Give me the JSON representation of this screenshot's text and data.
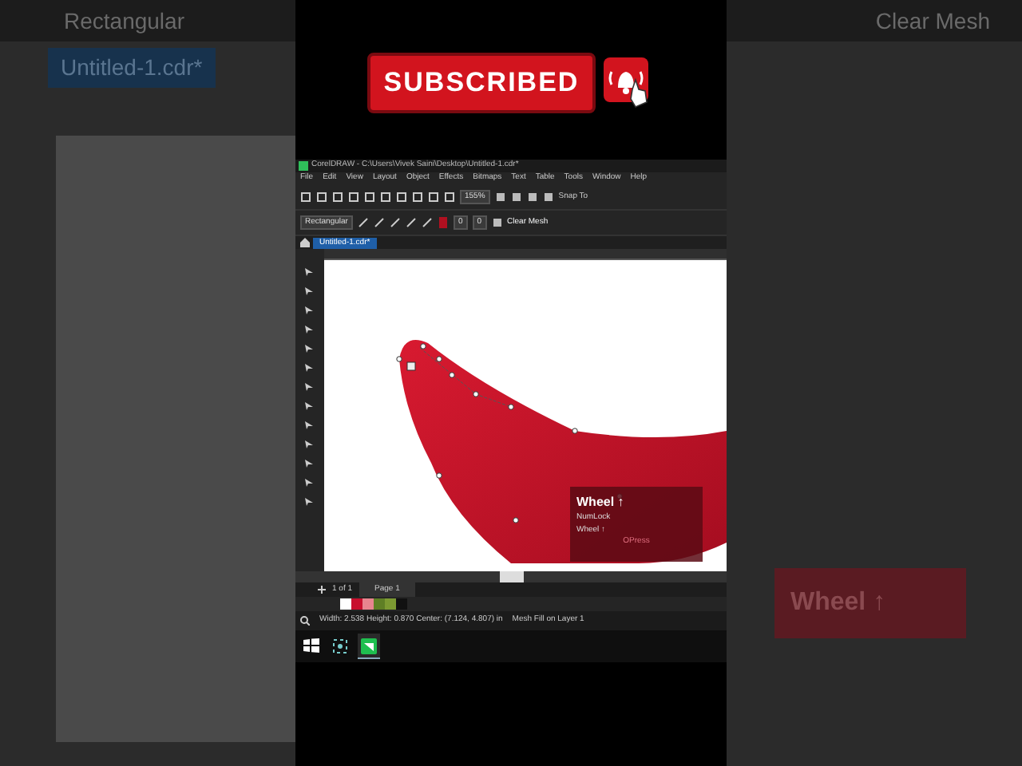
{
  "banner": {
    "label": "SUBSCRIBED"
  },
  "backdrop": {
    "tool_option": "Rectangular",
    "doc_tab": "Untitled-1.cdr*",
    "button": "Clear Mesh",
    "overlay": "Wheel ↑"
  },
  "window": {
    "title": "CorelDRAW - C:\\Users\\Vivek Saini\\Desktop\\Untitled-1.cdr*"
  },
  "menu": [
    "File",
    "Edit",
    "View",
    "Layout",
    "Object",
    "Effects",
    "Bitmaps",
    "Text",
    "Table",
    "Tools",
    "Window",
    "Help"
  ],
  "toolbar": {
    "zoom": "155%",
    "snap": "Snap To"
  },
  "property_bar": {
    "fill_type": "Rectangular",
    "rows": "0",
    "columns": "0",
    "clear_button": "Clear Mesh"
  },
  "doc_tabs": [
    {
      "label": "Untitled-1.cdr*",
      "selected": true
    }
  ],
  "key_overlay": {
    "key": "Wheel ↑",
    "lines": [
      "NumLock",
      "Wheel ↑"
    ],
    "footer": "OPress"
  },
  "page_nav": {
    "count": "1 of 1",
    "page_tab": "Page 1"
  },
  "palette": [
    {
      "color": "#ffffff"
    },
    {
      "color": "#c8102e"
    },
    {
      "color": "#e8858f"
    },
    {
      "color": "#5f7f25"
    },
    {
      "color": "#7c9a32"
    },
    {
      "color": "#111111"
    }
  ],
  "status": {
    "dimensions": "Width: 2.538  Height: 0.870  Center: (7.124, 4.807)  in",
    "layer": "Mesh Fill on Layer 1"
  },
  "taskbar": [
    {
      "kind": "windows",
      "active": false
    },
    {
      "kind": "capture",
      "active": false
    },
    {
      "kind": "corel",
      "active": true
    }
  ]
}
